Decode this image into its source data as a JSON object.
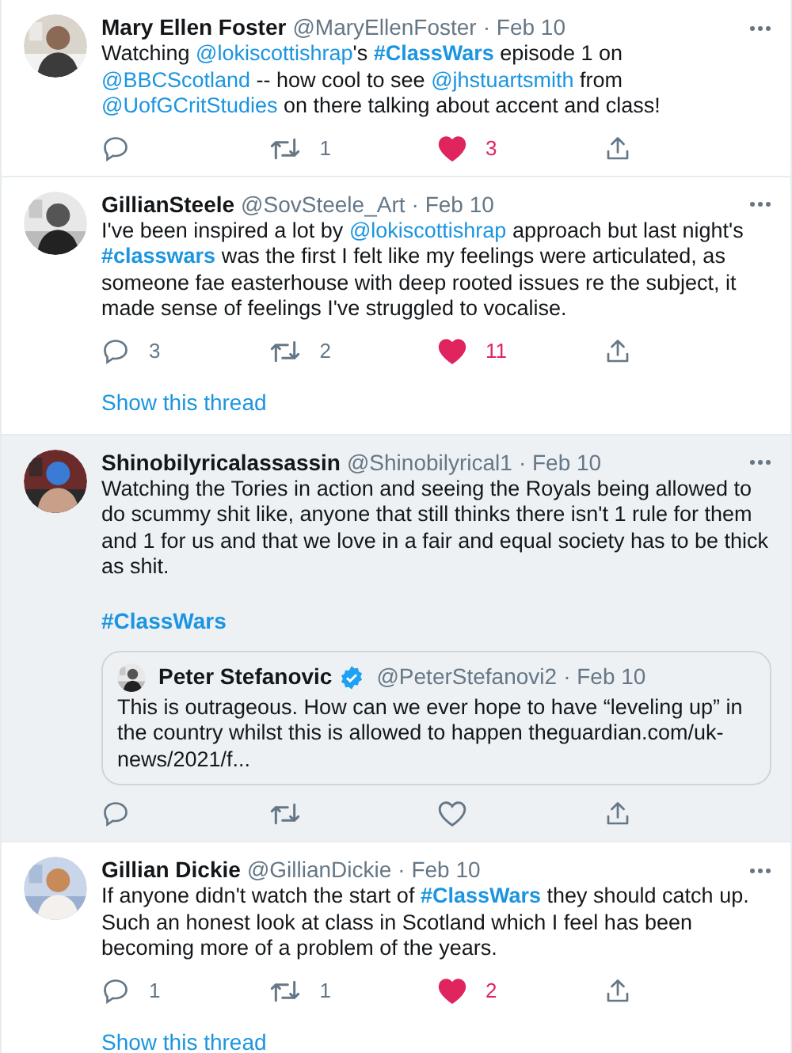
{
  "tweets": [
    {
      "name": "Mary Ellen Foster",
      "handle": "@MaryEllenFoster",
      "date": "· Feb 10",
      "highlighted": false,
      "paragraphs": [
        [
          {
            "kind": "text",
            "text": "Watching "
          },
          {
            "kind": "mention",
            "text": "@lokiscottishrap"
          },
          {
            "kind": "text",
            "text": "'s "
          },
          {
            "kind": "hashtag",
            "text": "#ClassWars"
          },
          {
            "kind": "text",
            "text": " episode 1 on "
          },
          {
            "kind": "mention",
            "text": "@BBCScotland"
          },
          {
            "kind": "text",
            "text": " -- how cool to see "
          },
          {
            "kind": "mention",
            "text": "@jhstuartsmith"
          },
          {
            "kind": "text",
            "text": " from "
          },
          {
            "kind": "mention",
            "text": "@UofGCritStudies"
          },
          {
            "kind": "text",
            "text": " on there talking about accent and class!"
          }
        ]
      ],
      "retweets": "1",
      "likes": "3",
      "liked": true
    },
    {
      "name": "GillianSteele",
      "handle": "@SovSteele_Art",
      "date": "· Feb 10",
      "highlighted": false,
      "paragraphs": [
        [
          {
            "kind": "text",
            "text": "I've been inspired a lot by "
          },
          {
            "kind": "mention",
            "text": "@lokiscottishrap"
          },
          {
            "kind": "text",
            "text": " approach but last night's "
          },
          {
            "kind": "hashtag",
            "text": "#classwars"
          },
          {
            "kind": "text",
            "text": " was the first I felt like my feelings were articulated, as someone fae easterhouse with deep rooted issues re the subject, it made sense of feelings I've struggled to vocalise."
          }
        ]
      ],
      "replies": "3",
      "retweets": "2",
      "likes": "11",
      "liked": true,
      "thread": "Show this thread"
    },
    {
      "name": "Shinobilyricalassassin",
      "handle": "@Shinobilyrical1",
      "date": "· Feb 10",
      "highlighted": true,
      "paragraphs": [
        [
          {
            "kind": "text",
            "text": "Watching the Tories in action and seeing the Royals being allowed to do scummy shit like, anyone that still thinks there isn't 1 rule for them and 1 for us and that we love in a fair and equal society has to be thick as shit."
          }
        ],
        [
          {
            "kind": "hashtag",
            "text": "#ClassWars"
          }
        ]
      ],
      "quote": {
        "name": "Peter Stefanovic",
        "verified": true,
        "handle": "@PeterStefanovi2",
        "date": "· Feb 10",
        "text": "This is outrageous. How can we ever hope to have “leveling up” in the country whilst this is allowed to happen theguardian.com/uk-news/2021/f..."
      },
      "liked": false
    },
    {
      "name": "Gillian Dickie",
      "handle": "@GillianDickie",
      "date": "· Feb 10",
      "highlighted": false,
      "paragraphs": [
        [
          {
            "kind": "text",
            "text": "If anyone didn't watch the start of "
          },
          {
            "kind": "hashtag",
            "text": "#ClassWars"
          },
          {
            "kind": "text",
            "text": " they should catch up. Such an honest look at class in Scotland which I feel has been becoming more of a problem of the years."
          }
        ]
      ],
      "replies": "1",
      "retweets": "1",
      "likes": "2",
      "liked": true,
      "thread": "Show this thread"
    }
  ]
}
